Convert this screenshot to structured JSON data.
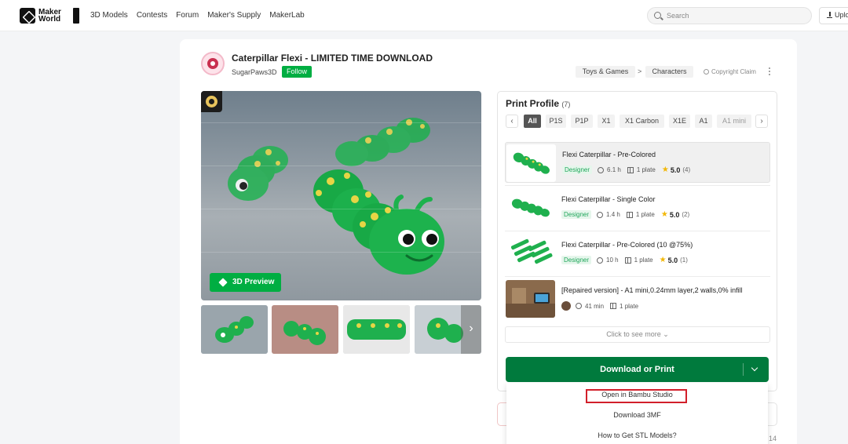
{
  "nav": {
    "logo_text": "Maker World",
    "links": [
      "3D Models",
      "Contests",
      "Forum",
      "Maker's Supply",
      "MakerLab"
    ],
    "search_placeholder": "Search",
    "upload_label": "Upload"
  },
  "model": {
    "title": "Caterpillar Flexi - LIMITED TIME DOWNLOAD",
    "author": "SugarPaws3D",
    "follow_label": "Follow",
    "breadcrumb": [
      "Toys & Games",
      "Characters"
    ],
    "breadcrumb_sep": ">",
    "copyright_label": "Copyright Claim",
    "preview_label": "3D Preview"
  },
  "print_profile": {
    "title": "Print Profile",
    "count": "(7)",
    "filters": [
      "All",
      "P1S",
      "P1P",
      "X1",
      "X1 Carbon",
      "X1E",
      "A1",
      "A1 mini"
    ],
    "active_filter": "All",
    "prev_arrow": "‹",
    "next_arrow": "›",
    "profiles": [
      {
        "name": "Flexi Caterpillar - Pre-Colored",
        "tag": "Designer",
        "time": "6.1 h",
        "plates": "1 plate",
        "rating": "5.0",
        "ratings_count": "(4)"
      },
      {
        "name": "Flexi Caterpillar - Single Color",
        "tag": "Designer",
        "time": "1.4 h",
        "plates": "1 plate",
        "rating": "5.0",
        "ratings_count": "(2)"
      },
      {
        "name": "Flexi Caterpillar - Pre-Colored (10 @75%)",
        "tag": "Designer",
        "time": "10 h",
        "plates": "1 plate",
        "rating": "5.0",
        "ratings_count": "(1)"
      },
      {
        "name": "[Repaired version] - A1 mini,0.24mm layer,2 walls,0% infill",
        "time": "41 min",
        "plates": "1 plate"
      }
    ],
    "see_more_label": "Click to see more"
  },
  "download": {
    "button_label": "Download or Print",
    "menu": [
      "Open in Bambu Studio",
      "Download 3MF",
      "How to Get STL Models?"
    ],
    "highlighted_item": "Open in Bambu Studio"
  },
  "footer_number": "14",
  "colors": {
    "brand_green": "#00ae42",
    "download_green": "#007a3d",
    "highlight_red": "#d21f2a"
  }
}
